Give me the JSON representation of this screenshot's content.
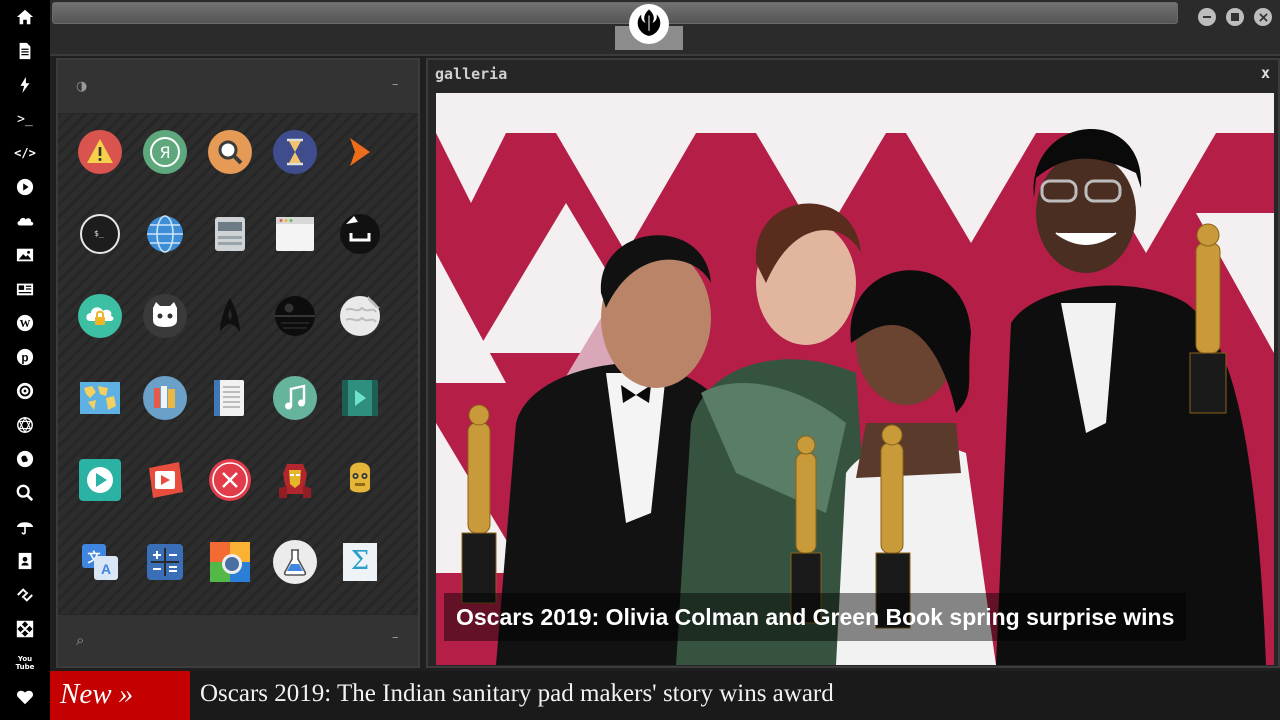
{
  "dock": {
    "items": [
      "home-icon",
      "document-icon",
      "lightning-icon",
      "terminal-icon",
      "code-icon",
      "play-icon",
      "cloud-icon",
      "image-icon",
      "news-icon",
      "wordpress-icon",
      "pinterest-icon",
      "settings-icon",
      "globe-icon",
      "location-icon",
      "search-icon",
      "umbrella-icon",
      "contacts-icon",
      "link-icon",
      "expand-icon",
      "youtube-icon",
      "heart-icon"
    ],
    "terminal_glyph": ">_",
    "code_glyph": "</>",
    "youtube_glyph": "You Tube"
  },
  "window": {
    "logo": "rebel-alliance-icon",
    "controls": [
      "minimize-icon",
      "maximize-icon",
      "close-icon"
    ]
  },
  "launcher": {
    "top_left_glyph": "◑",
    "top_right_glyph": "–",
    "bottom_left_glyph": "⌕",
    "bottom_right_glyph": "–",
    "apps": [
      [
        "warning-app-icon",
        "yandex-app-icon",
        "search-app-icon",
        "hourglass-app-icon",
        "arrow-app-icon"
      ],
      [
        "terminal-app-icon",
        "globe-app-icon",
        "scanner-app-icon",
        "window-app-icon",
        "terminal-dark-app-icon"
      ],
      [
        "cloud-lock-app-icon",
        "github-app-icon",
        "star-trek-app-icon",
        "death-star-app-icon",
        "wikipedia-app-icon"
      ],
      [
        "world-map-app-icon",
        "books-app-icon",
        "notes-app-icon",
        "music-app-icon",
        "video-app-icon"
      ],
      [
        "play-app-icon",
        "video-red-app-icon",
        "cancel-app-icon",
        "iron-man-app-icon",
        "c3po-app-icon"
      ],
      [
        "translate-app-icon",
        "calculator-app-icon",
        "photo-app-icon",
        "lab-app-icon",
        "sigma-app-icon"
      ]
    ]
  },
  "gallery": {
    "title": "galleria",
    "close_label": "x",
    "caption": "Oscars 2019: Olivia Colman and Green Book spring surprise wins"
  },
  "ticker": {
    "badge": "New »",
    "headline": "Oscars 2019: The Indian sanitary pad makers' story wins award"
  },
  "colors": {
    "badge_red": "#c40000",
    "backdrop_magenta": "#b01d45"
  }
}
